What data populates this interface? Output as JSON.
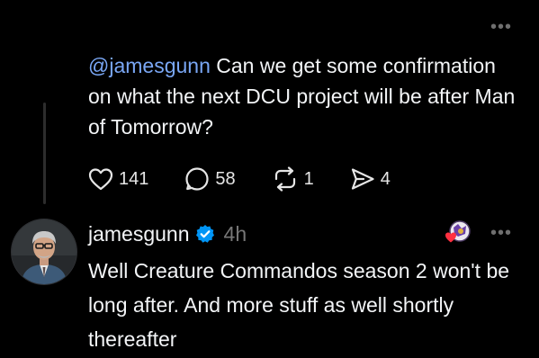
{
  "parent_post": {
    "mention": "@jamesgunn",
    "text": " Can we get some confirmation on what the next DCU project will be after Man of Tomorrow?",
    "likes": "141",
    "replies": "58",
    "reposts": "1",
    "shares": "4"
  },
  "reply": {
    "username": "jamesgunn",
    "timestamp": "4h",
    "text": "Well Creature Commandos season 2 won't be long after. And more stuff as well shortly thereafter"
  },
  "menu": {
    "more_label": "•••"
  },
  "colors": {
    "background": "#000000",
    "text": "#f3f5f7",
    "mention": "#7aa7f5",
    "muted": "#777777",
    "verified": "#0095f6",
    "like_heart": "#ff3040"
  }
}
